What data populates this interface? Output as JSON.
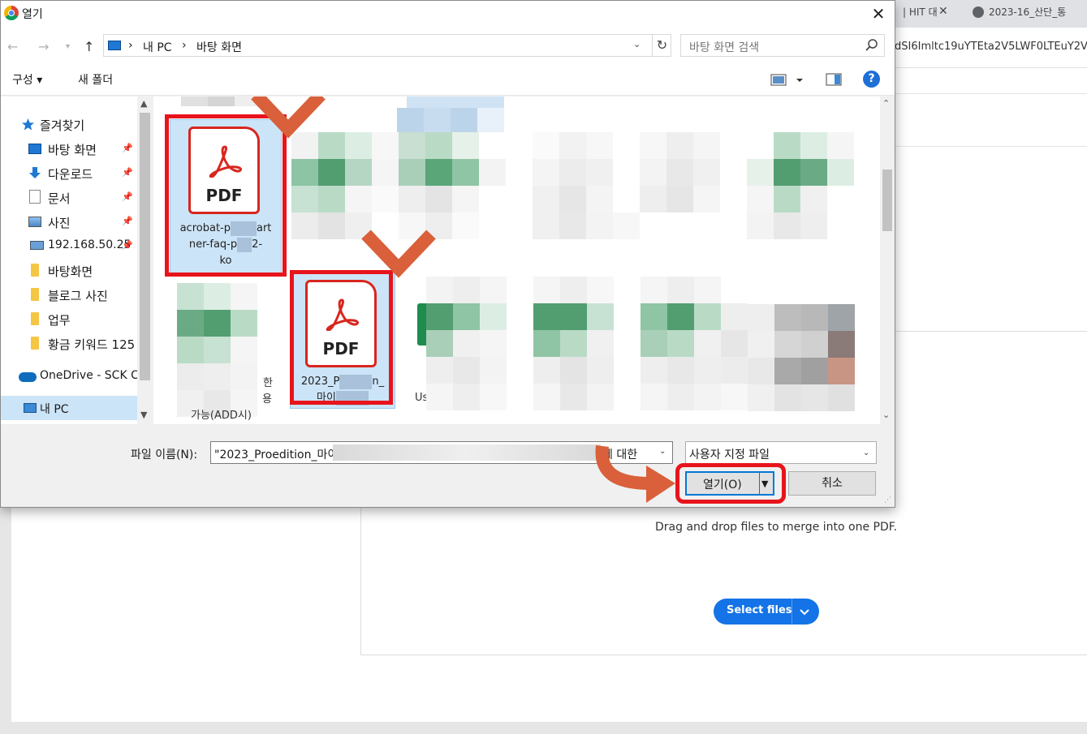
{
  "browser": {
    "tab1_label": "| HIT 대",
    "tab2_label": "2023-16_산단_통",
    "url_fragment": "dSI6Imltc19uYTEta2V5LWF0LTEuY2Vy"
  },
  "page": {
    "drop_text": "Drag and drop files to merge into one PDF.",
    "select_files_label": "Select files"
  },
  "dialog": {
    "title": "열기",
    "close_glyph": "✕",
    "address": {
      "part1": "내 PC",
      "part2": "바탕 화면",
      "separator": "›"
    },
    "search_placeholder": "바탕 화면 검색",
    "toolbar": {
      "organize": "구성 ▾",
      "new_folder": "새 폴더",
      "help": "?"
    },
    "nav_items": [
      {
        "label": "즐겨찾기"
      },
      {
        "label": "바탕 화면"
      },
      {
        "label": "다운로드"
      },
      {
        "label": "문서"
      },
      {
        "label": "사진"
      },
      {
        "label": "192.168.50.25"
      },
      {
        "label": "바탕화면"
      },
      {
        "label": "블로그 사진"
      },
      {
        "label": "업무"
      },
      {
        "label": "황금 키워드 125"
      },
      {
        "label": "OneDrive - SCK C"
      },
      {
        "label": "내 PC"
      }
    ],
    "files": {
      "file1_name_a": "acrobat-p",
      "file1_name_a2": "art",
      "file1_name_b": "ner-faq-p",
      "file1_name_b2": "2-",
      "file1_name_c": "ko",
      "file2_name_a": "2023_P",
      "file2_name_a2": "n_",
      "file2_name_b": "마이",
      "pdf_label": "PDF",
      "partial_a": "가능(ADD시)",
      "partial_b": "Us",
      "partial_c": "한",
      "partial_d": "용"
    },
    "filename_label": "파일 이름(N):",
    "filename_value": "\"2023_Proedition_마이.",
    "filename_tail": "에 대한",
    "filetype_value": "사용자 지정 파일",
    "open_label": "열기(O)",
    "cancel_label": "취소"
  },
  "colors": {
    "accent_blue": "#1473e6",
    "annotation_red": "#e8141c",
    "check_orange": "#d9603a",
    "pdf_red": "#d8261e"
  }
}
